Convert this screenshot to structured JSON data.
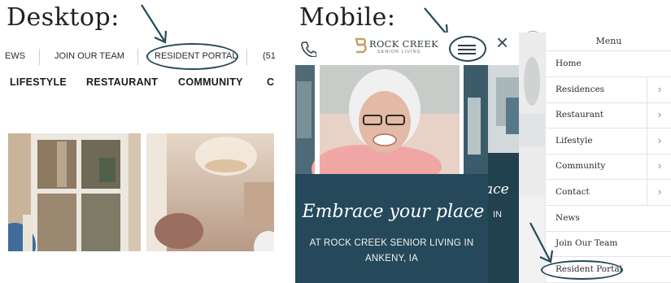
{
  "desktop": {
    "title": "Desktop:",
    "top_nav": [
      "EWS",
      "JOIN OUR TEAM",
      "RESIDENT PORTAL",
      "(51"
    ],
    "main_nav": [
      "LIFESTYLE",
      "RESTAURANT",
      "COMMUNITY",
      "C"
    ]
  },
  "mobile": {
    "title": "Mobile:",
    "logo_name": "ROCK CREEK",
    "logo_tagline": "SENIOR LIVING",
    "hero_script": "Embrace your place",
    "hero_sub_line1": "AT ROCK CREEK SENIOR LIVING IN",
    "hero_sub_line2": "ANKENY, IA",
    "strip_text1": "ace",
    "strip_text2": "IN",
    "close_glyph": "×"
  },
  "menu": {
    "title": "Menu",
    "items": [
      {
        "label": "Home",
        "has_sub": false
      },
      {
        "label": "Residences",
        "has_sub": true
      },
      {
        "label": "Restaurant",
        "has_sub": true
      },
      {
        "label": "Lifestyle",
        "has_sub": true
      },
      {
        "label": "Community",
        "has_sub": true
      },
      {
        "label": "Contact",
        "has_sub": true
      },
      {
        "label": "News",
        "has_sub": false
      },
      {
        "label": "Join Our Team",
        "has_sub": false
      },
      {
        "label": "Resident Portal",
        "has_sub": false
      }
    ],
    "chevron": "›"
  },
  "colors": {
    "brand_teal": "#25495a",
    "annotation": "#264a57",
    "logo_gold": "#c9a063"
  },
  "icons": [
    "arrow-annotation-icon",
    "phone-icon",
    "hamburger-menu-icon",
    "close-icon",
    "chevron-right-icon",
    "logo-mark-icon"
  ]
}
